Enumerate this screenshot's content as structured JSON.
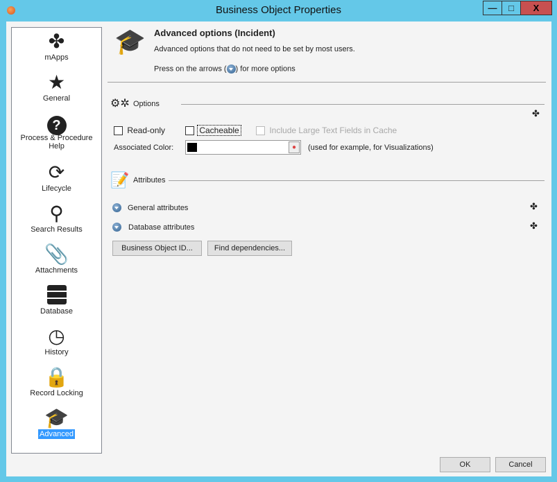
{
  "window": {
    "title": "Business Object Properties",
    "minimize": "—",
    "maximize": "□",
    "close": "X"
  },
  "sidebar": {
    "items": [
      {
        "label": "mApps",
        "icon": "puzzle-icon"
      },
      {
        "label": "General",
        "icon": "star-icon"
      },
      {
        "label": "Process & Procedure Help",
        "icon": "question-icon"
      },
      {
        "label": "Lifecycle",
        "icon": "refresh-icon"
      },
      {
        "label": "Search Results",
        "icon": "search-icon"
      },
      {
        "label": "Attachments",
        "icon": "paperclip-icon"
      },
      {
        "label": "Database",
        "icon": "database-icon"
      },
      {
        "label": "History",
        "icon": "history-icon"
      },
      {
        "label": "Record Locking",
        "icon": "lock-icon"
      },
      {
        "label": "Advanced",
        "icon": "graduation-cap-icon",
        "selected": true
      }
    ]
  },
  "header": {
    "title": "Advanced options  (Incident)",
    "subtitle": "Advanced options that do not need to be set by most users.",
    "press_prefix": "Press on the arrows (",
    "press_suffix": ") for more options"
  },
  "options": {
    "label": "Options",
    "readonly": {
      "label": "Read-only",
      "checked": false
    },
    "cacheable": {
      "label": "Cacheable",
      "checked": false
    },
    "large_text": {
      "label": "Include Large Text Fields in Cache",
      "checked": false,
      "disabled": true
    },
    "color_label": "Associated Color:",
    "color_value": "#000000",
    "color_note": "(used for example, for Visualizations)"
  },
  "attributes": {
    "label": "Attributes",
    "general": "General attributes",
    "database": "Database attributes"
  },
  "buttons": {
    "bo_id": "Business Object ID...",
    "find_deps": "Find dependencies...",
    "ok": "OK",
    "cancel": "Cancel"
  },
  "colors": {
    "titlebar": "#64c8e8",
    "close": "#c75050",
    "selection": "#3399ff"
  }
}
